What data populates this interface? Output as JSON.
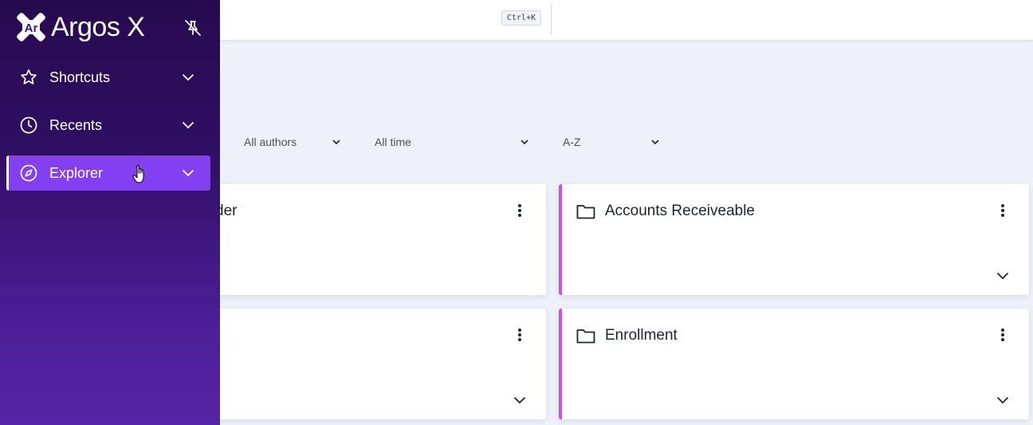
{
  "app": {
    "name": "Argos X"
  },
  "topbar": {
    "shortcut_hint": "Ctrl+K"
  },
  "filters": {
    "authors": "All authors",
    "time": "All time",
    "sort": "A-Z"
  },
  "sidebar": {
    "items": [
      {
        "label": "Shortcuts",
        "icon": "star-icon"
      },
      {
        "label": "Recents",
        "icon": "clock-icon"
      },
      {
        "label": "Explorer",
        "icon": "compass-icon",
        "active": true
      }
    ]
  },
  "cards": [
    {
      "title": "der",
      "partial": true
    },
    {
      "title": "Accounts Receiveable"
    },
    {
      "title": ""
    },
    {
      "title": "Enrollment"
    }
  ],
  "colors": {
    "sidebar_top": "#260a4e",
    "sidebar_bottom": "#5425a8",
    "active_item": "#8340f0",
    "card_accent": "#d34fe0",
    "background": "#eef2f8"
  }
}
